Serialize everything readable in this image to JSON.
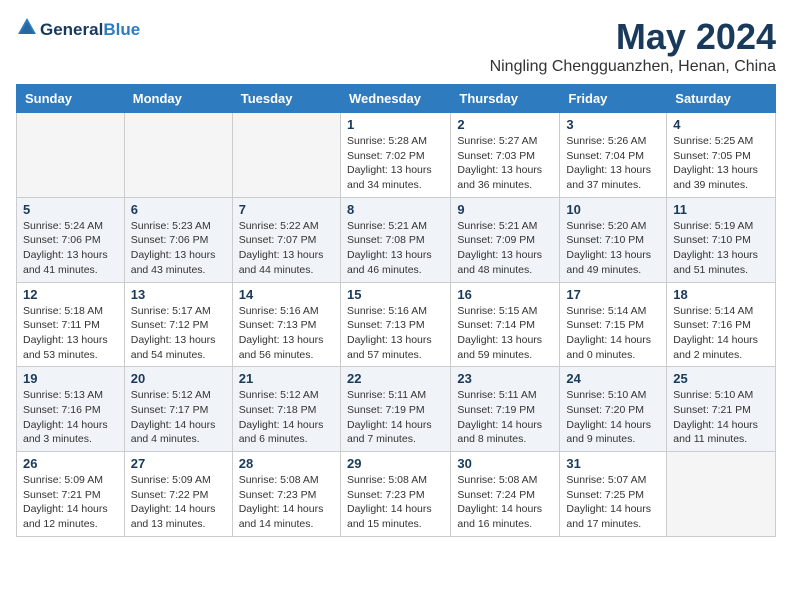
{
  "logo": {
    "general": "General",
    "blue": "Blue"
  },
  "title": {
    "month_year": "May 2024",
    "location": "Ningling Chengguanzhen, Henan, China"
  },
  "headers": [
    "Sunday",
    "Monday",
    "Tuesday",
    "Wednesday",
    "Thursday",
    "Friday",
    "Saturday"
  ],
  "weeks": [
    [
      {
        "day": "",
        "info": ""
      },
      {
        "day": "",
        "info": ""
      },
      {
        "day": "",
        "info": ""
      },
      {
        "day": "1",
        "info": "Sunrise: 5:28 AM\nSunset: 7:02 PM\nDaylight: 13 hours\nand 34 minutes."
      },
      {
        "day": "2",
        "info": "Sunrise: 5:27 AM\nSunset: 7:03 PM\nDaylight: 13 hours\nand 36 minutes."
      },
      {
        "day": "3",
        "info": "Sunrise: 5:26 AM\nSunset: 7:04 PM\nDaylight: 13 hours\nand 37 minutes."
      },
      {
        "day": "4",
        "info": "Sunrise: 5:25 AM\nSunset: 7:05 PM\nDaylight: 13 hours\nand 39 minutes."
      }
    ],
    [
      {
        "day": "5",
        "info": "Sunrise: 5:24 AM\nSunset: 7:06 PM\nDaylight: 13 hours\nand 41 minutes."
      },
      {
        "day": "6",
        "info": "Sunrise: 5:23 AM\nSunset: 7:06 PM\nDaylight: 13 hours\nand 43 minutes."
      },
      {
        "day": "7",
        "info": "Sunrise: 5:22 AM\nSunset: 7:07 PM\nDaylight: 13 hours\nand 44 minutes."
      },
      {
        "day": "8",
        "info": "Sunrise: 5:21 AM\nSunset: 7:08 PM\nDaylight: 13 hours\nand 46 minutes."
      },
      {
        "day": "9",
        "info": "Sunrise: 5:21 AM\nSunset: 7:09 PM\nDaylight: 13 hours\nand 48 minutes."
      },
      {
        "day": "10",
        "info": "Sunrise: 5:20 AM\nSunset: 7:10 PM\nDaylight: 13 hours\nand 49 minutes."
      },
      {
        "day": "11",
        "info": "Sunrise: 5:19 AM\nSunset: 7:10 PM\nDaylight: 13 hours\nand 51 minutes."
      }
    ],
    [
      {
        "day": "12",
        "info": "Sunrise: 5:18 AM\nSunset: 7:11 PM\nDaylight: 13 hours\nand 53 minutes."
      },
      {
        "day": "13",
        "info": "Sunrise: 5:17 AM\nSunset: 7:12 PM\nDaylight: 13 hours\nand 54 minutes."
      },
      {
        "day": "14",
        "info": "Sunrise: 5:16 AM\nSunset: 7:13 PM\nDaylight: 13 hours\nand 56 minutes."
      },
      {
        "day": "15",
        "info": "Sunrise: 5:16 AM\nSunset: 7:13 PM\nDaylight: 13 hours\nand 57 minutes."
      },
      {
        "day": "16",
        "info": "Sunrise: 5:15 AM\nSunset: 7:14 PM\nDaylight: 13 hours\nand 59 minutes."
      },
      {
        "day": "17",
        "info": "Sunrise: 5:14 AM\nSunset: 7:15 PM\nDaylight: 14 hours\nand 0 minutes."
      },
      {
        "day": "18",
        "info": "Sunrise: 5:14 AM\nSunset: 7:16 PM\nDaylight: 14 hours\nand 2 minutes."
      }
    ],
    [
      {
        "day": "19",
        "info": "Sunrise: 5:13 AM\nSunset: 7:16 PM\nDaylight: 14 hours\nand 3 minutes."
      },
      {
        "day": "20",
        "info": "Sunrise: 5:12 AM\nSunset: 7:17 PM\nDaylight: 14 hours\nand 4 minutes."
      },
      {
        "day": "21",
        "info": "Sunrise: 5:12 AM\nSunset: 7:18 PM\nDaylight: 14 hours\nand 6 minutes."
      },
      {
        "day": "22",
        "info": "Sunrise: 5:11 AM\nSunset: 7:19 PM\nDaylight: 14 hours\nand 7 minutes."
      },
      {
        "day": "23",
        "info": "Sunrise: 5:11 AM\nSunset: 7:19 PM\nDaylight: 14 hours\nand 8 minutes."
      },
      {
        "day": "24",
        "info": "Sunrise: 5:10 AM\nSunset: 7:20 PM\nDaylight: 14 hours\nand 9 minutes."
      },
      {
        "day": "25",
        "info": "Sunrise: 5:10 AM\nSunset: 7:21 PM\nDaylight: 14 hours\nand 11 minutes."
      }
    ],
    [
      {
        "day": "26",
        "info": "Sunrise: 5:09 AM\nSunset: 7:21 PM\nDaylight: 14 hours\nand 12 minutes."
      },
      {
        "day": "27",
        "info": "Sunrise: 5:09 AM\nSunset: 7:22 PM\nDaylight: 14 hours\nand 13 minutes."
      },
      {
        "day": "28",
        "info": "Sunrise: 5:08 AM\nSunset: 7:23 PM\nDaylight: 14 hours\nand 14 minutes."
      },
      {
        "day": "29",
        "info": "Sunrise: 5:08 AM\nSunset: 7:23 PM\nDaylight: 14 hours\nand 15 minutes."
      },
      {
        "day": "30",
        "info": "Sunrise: 5:08 AM\nSunset: 7:24 PM\nDaylight: 14 hours\nand 16 minutes."
      },
      {
        "day": "31",
        "info": "Sunrise: 5:07 AM\nSunset: 7:25 PM\nDaylight: 14 hours\nand 17 minutes."
      },
      {
        "day": "",
        "info": ""
      }
    ]
  ]
}
